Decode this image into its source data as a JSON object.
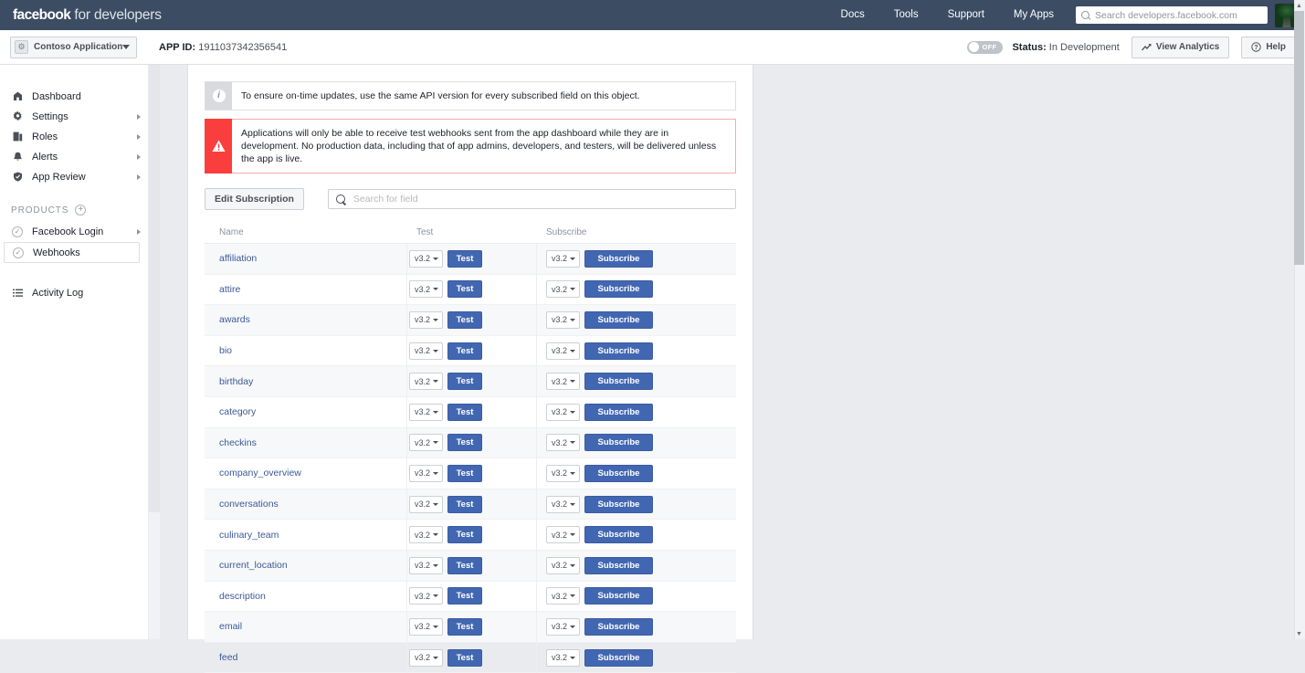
{
  "topnav": {
    "brand_bold": "facebook",
    "brand_rest": " for developers",
    "links": [
      {
        "label": "Docs"
      },
      {
        "label": "Tools"
      },
      {
        "label": "Support"
      },
      {
        "label": "My Apps"
      }
    ],
    "search": {
      "placeholder": "Search developers.facebook.com",
      "value": ""
    },
    "avatar_name": "user-avatar"
  },
  "appbar": {
    "app_name": "Contoso Application",
    "app_id_label": "APP ID:",
    "app_id_value": "1911037342356541",
    "toggle_state": "OFF",
    "status_label": "Status:",
    "status_value": "In Development",
    "view_analytics": "View Analytics",
    "help": "Help"
  },
  "sidebar": {
    "items": [
      {
        "label": "Dashboard",
        "icon": "dashboard-icon",
        "arrow": false
      },
      {
        "label": "Settings",
        "icon": "gear-icon",
        "arrow": true
      },
      {
        "label": "Roles",
        "icon": "roles-icon",
        "arrow": true
      },
      {
        "label": "Alerts",
        "icon": "bell-icon",
        "arrow": true
      },
      {
        "label": "App Review",
        "icon": "shield-icon",
        "arrow": true
      }
    ],
    "products_header": "PRODUCTS",
    "products": [
      {
        "label": "Facebook Login",
        "arrow": true,
        "selected": false
      },
      {
        "label": "Webhooks",
        "arrow": false,
        "selected": true
      }
    ],
    "activity_log": {
      "label": "Activity Log",
      "icon": "list-icon"
    }
  },
  "main": {
    "banner_info": {
      "icon": "info-icon",
      "text": "To ensure on-time updates, use the same API version for every subscribed field on this object."
    },
    "banner_warning": {
      "icon": "warning-icon",
      "text": "Applications will only be able to receive test webhooks sent from the app dashboard while they are in development. No production data, including that of app admins, developers, and testers, will be delivered unless the app is live."
    },
    "edit_subscription_label": "Edit Subscription",
    "field_search": {
      "placeholder": "Search for field",
      "value": ""
    },
    "table": {
      "columns": [
        "Name",
        "Test",
        "Subscribe"
      ],
      "test_button_label": "Test",
      "subscribe_button_label": "Subscribe",
      "default_version": "v3.2",
      "rows": [
        {
          "name": "affiliation",
          "test_version": "v3.2",
          "subscribe_version": "v3.2"
        },
        {
          "name": "attire",
          "test_version": "v3.2",
          "subscribe_version": "v3.2"
        },
        {
          "name": "awards",
          "test_version": "v3.2",
          "subscribe_version": "v3.2"
        },
        {
          "name": "bio",
          "test_version": "v3.2",
          "subscribe_version": "v3.2"
        },
        {
          "name": "birthday",
          "test_version": "v3.2",
          "subscribe_version": "v3.2"
        },
        {
          "name": "category",
          "test_version": "v3.2",
          "subscribe_version": "v3.2"
        },
        {
          "name": "checkins",
          "test_version": "v3.2",
          "subscribe_version": "v3.2"
        },
        {
          "name": "company_overview",
          "test_version": "v3.2",
          "subscribe_version": "v3.2"
        },
        {
          "name": "conversations",
          "test_version": "v3.2",
          "subscribe_version": "v3.2"
        },
        {
          "name": "culinary_team",
          "test_version": "v3.2",
          "subscribe_version": "v3.2"
        },
        {
          "name": "current_location",
          "test_version": "v3.2",
          "subscribe_version": "v3.2"
        },
        {
          "name": "description",
          "test_version": "v3.2",
          "subscribe_version": "v3.2"
        },
        {
          "name": "email",
          "test_version": "v3.2",
          "subscribe_version": "v3.2"
        },
        {
          "name": "feed",
          "test_version": "v3.2",
          "subscribe_version": "v3.2"
        }
      ]
    }
  },
  "colors": {
    "navbar": "#3b4c63",
    "brand_blue": "#4267b2",
    "link_blue": "#3b5998",
    "warning_red": "#fa3e3e",
    "page_bg": "#e9ebee"
  }
}
